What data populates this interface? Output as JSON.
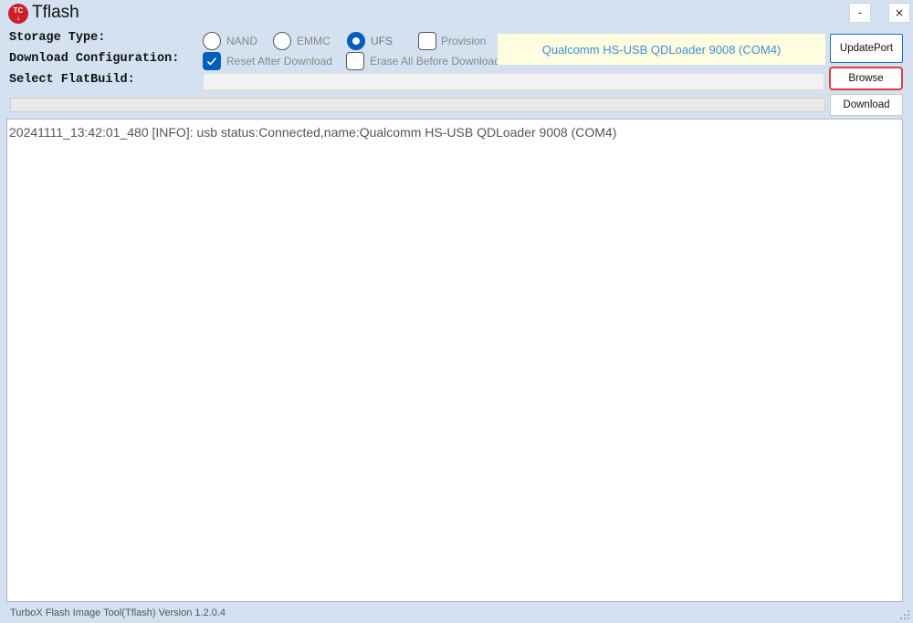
{
  "window": {
    "title": "Tflash",
    "logo_text": "TC",
    "minimize_label": "-",
    "close_label": "×"
  },
  "labels": {
    "storage_type": "Storage Type:",
    "download_config": "Download Configuration:",
    "select_flatbuild": "Select FlatBuild:"
  },
  "storage_options": [
    {
      "label": "NAND",
      "checked": false
    },
    {
      "label": "EMMC",
      "checked": false
    },
    {
      "label": "UFS",
      "checked": true
    }
  ],
  "checkboxes": {
    "provision": {
      "label": "Provision",
      "checked": false
    },
    "reset_after_download": {
      "label": "Reset After Download",
      "checked": true
    },
    "erase_all": {
      "label": "Erase All Before Download",
      "checked": false
    }
  },
  "port": {
    "text": "Qualcomm HS-USB QDLoader 9008 (COM4)"
  },
  "buttons": {
    "update_port": "UpdatePort",
    "browse": "Browse",
    "download": "Download"
  },
  "flatbuild_path": "",
  "progress": 0,
  "log_lines": [
    "20241111_13:42:01_480 [INFO]: usb status:Connected,name:Qualcomm HS-USB QDLoader 9008 (COM4)"
  ],
  "status_bar": {
    "text": "TurboX Flash Image Tool(Tflash) Version 1.2.0.4"
  },
  "colors": {
    "accent": "#005fb8",
    "highlight_border": "#e33d3d",
    "port_text": "#3d8fd6",
    "port_bg": "#fffde0"
  }
}
